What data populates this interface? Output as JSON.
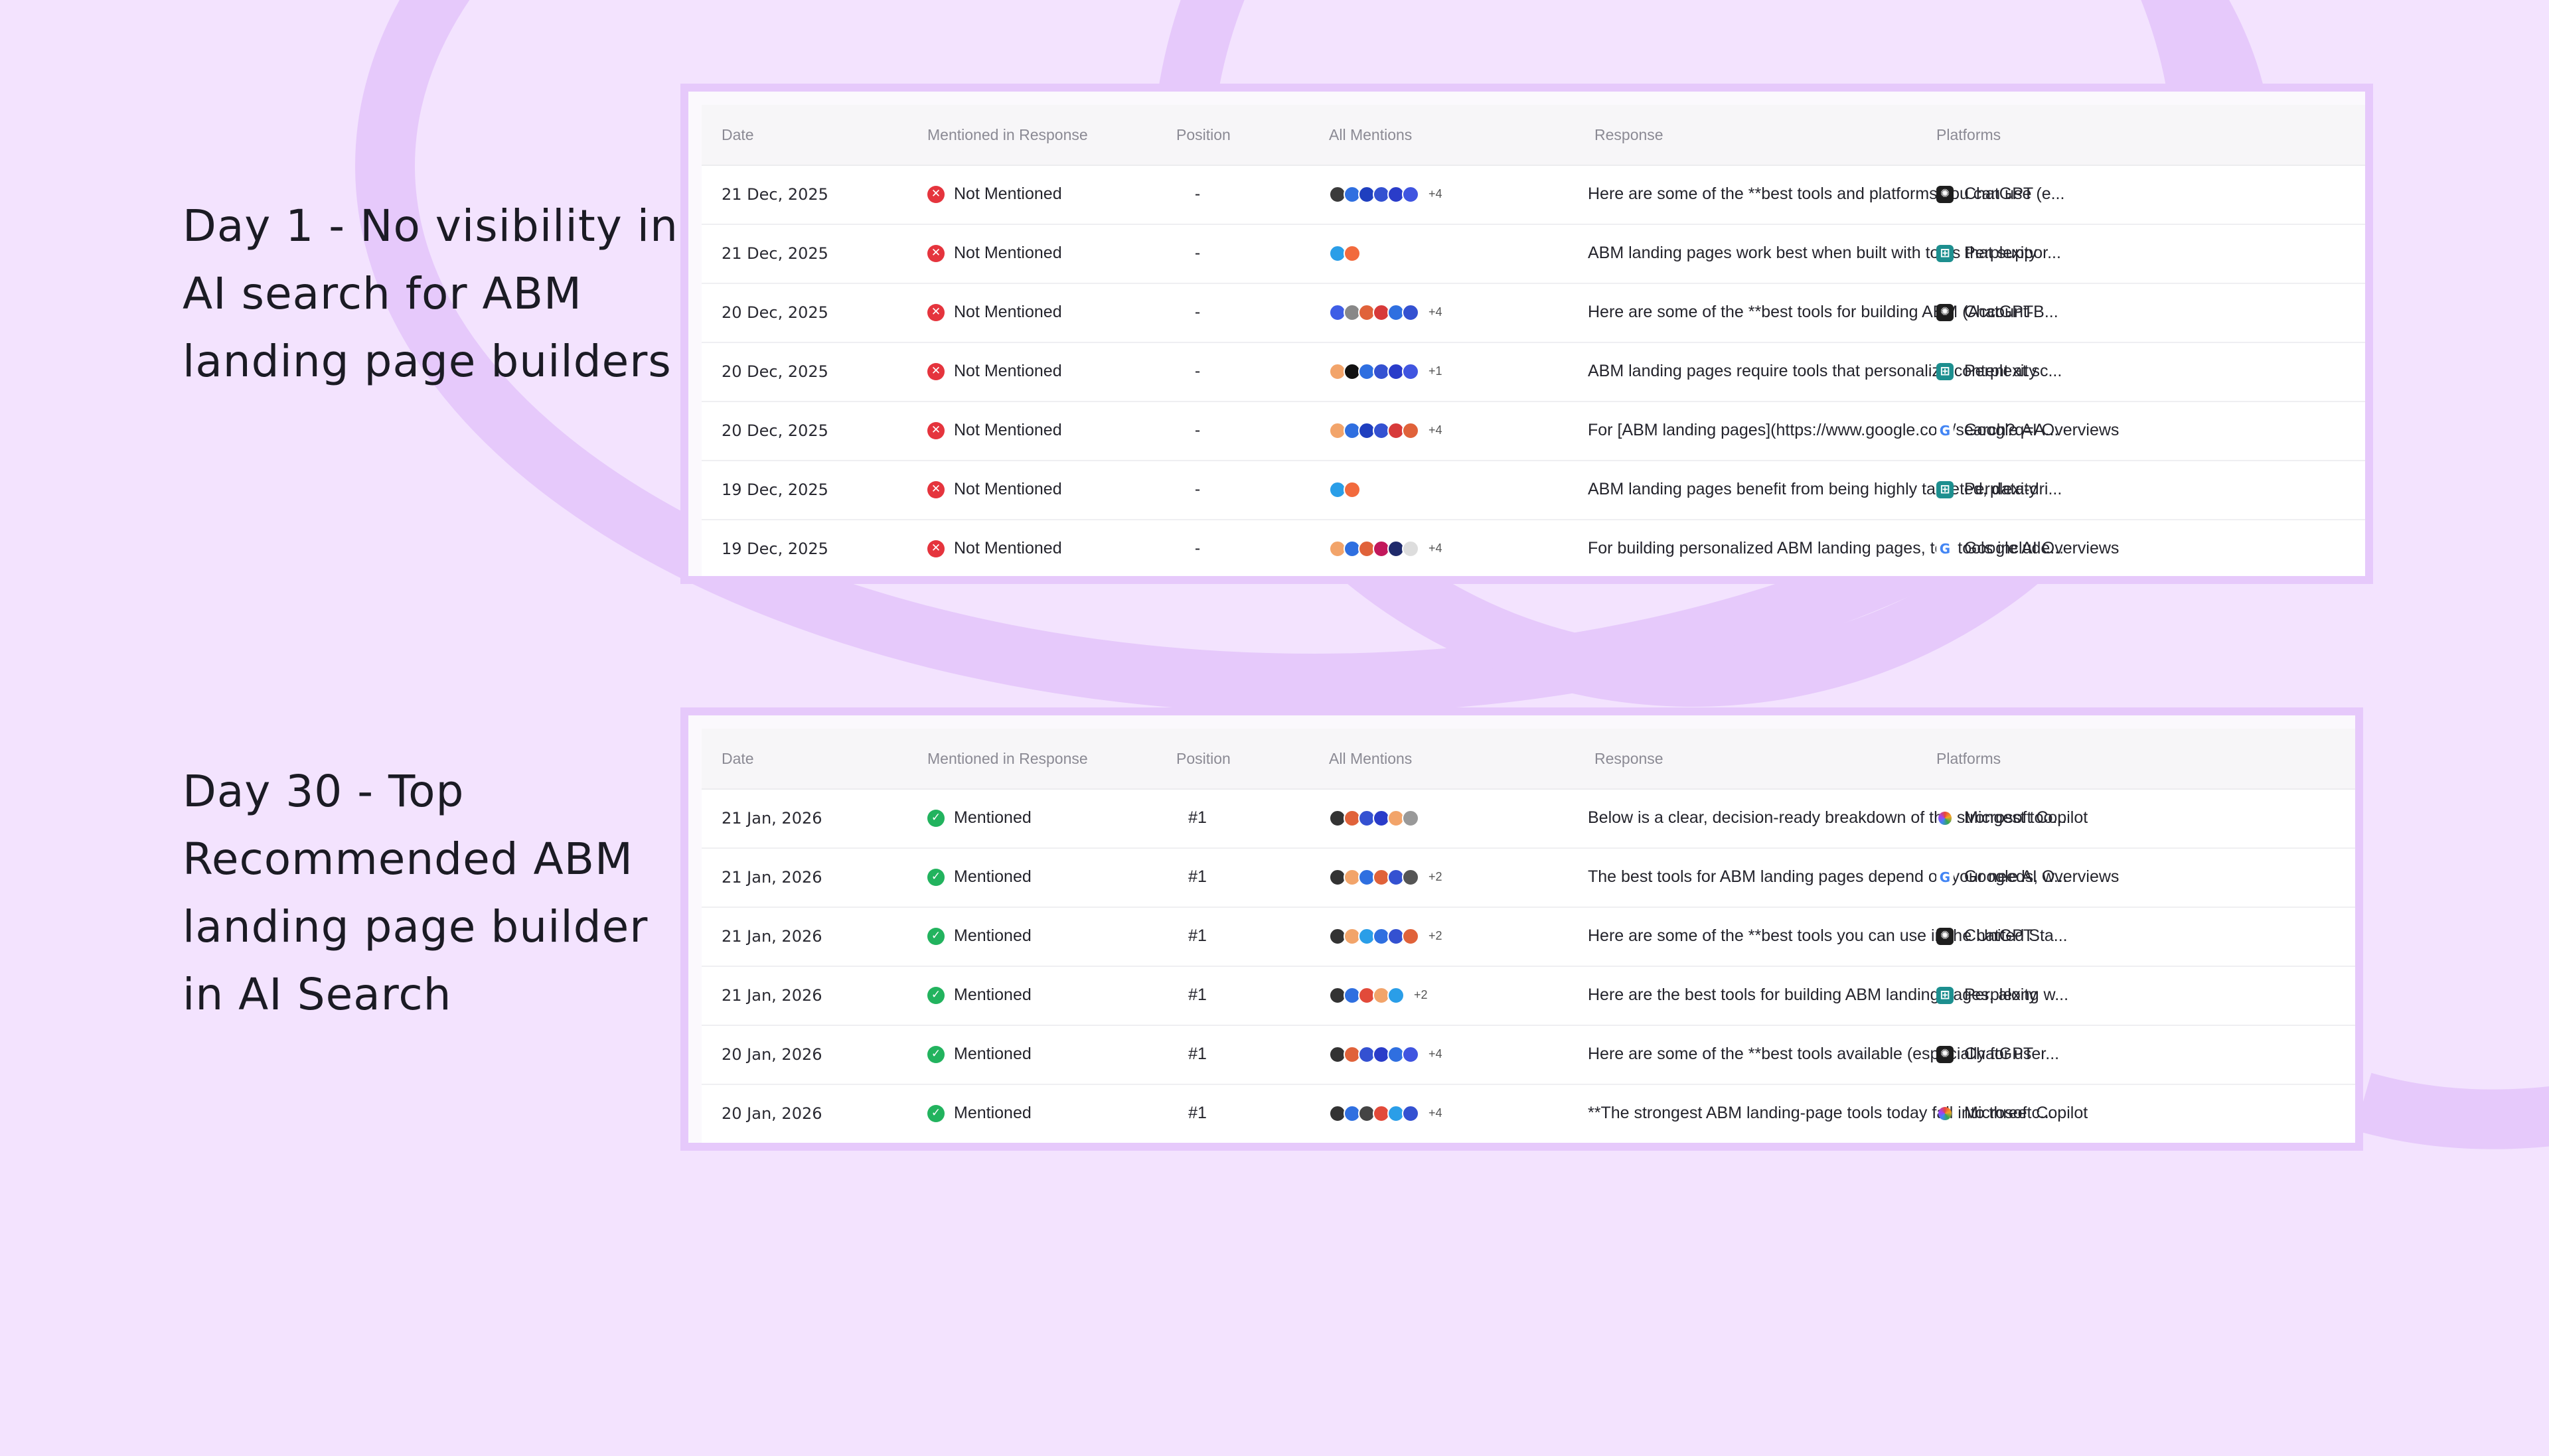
{
  "caption_day1": "Day 1 - No visibility in\nAI search for ABM\nlanding page builders",
  "caption_day30": "Day 30 - Top\nRecommended ABM\nlanding page builder\nin AI Search",
  "columns": {
    "date": "Date",
    "mentioned": "Mentioned in Response",
    "position": "Position",
    "all_mentions": "All Mentions",
    "response": "Response",
    "platforms": "Platforms"
  },
  "colors": {
    "background": "#f3e3fe",
    "accent_purple": "#e6c9fb",
    "not_mentioned_red": "#e5343d",
    "mentioned_green": "#22b35e"
  },
  "table_day1": [
    {
      "date": "21 Dec, 2025",
      "status": "Not Mentioned",
      "status_icon": "x-circle-icon",
      "position": "-",
      "logos": [
        "#3b3b3b",
        "#2f6fe0",
        "#1f3fbf",
        "#3451d1",
        "#2a3cc9",
        "#4055e0"
      ],
      "extra": "+4",
      "response": "Here are some of the **best tools and platforms you can use (e...",
      "platform": "ChatGPT",
      "platform_icon": "chatgpt-icon",
      "platform_color": "#1e1e1e"
    },
    {
      "date": "21 Dec, 2025",
      "status": "Not Mentioned",
      "status_icon": "x-circle-icon",
      "position": "-",
      "logos": [
        "#2a9ee8",
        "#f26a3d"
      ],
      "extra": "",
      "response": "ABM landing pages work best when built with tools that suppor...",
      "platform": "Perplexity",
      "platform_icon": "perplexity-icon",
      "platform_color": "#1d8f8f"
    },
    {
      "date": "20 Dec, 2025",
      "status": "Not Mentioned",
      "status_icon": "x-circle-icon",
      "position": "-",
      "logos": [
        "#3f5ee6",
        "#888888",
        "#e0623a",
        "#d73a3a",
        "#2f6fe0",
        "#3451d1"
      ],
      "extra": "+4",
      "response": "Here are some of the **best tools for building ABM (Account-B...",
      "platform": "ChatGPT",
      "platform_icon": "chatgpt-icon",
      "platform_color": "#1e1e1e"
    },
    {
      "date": "20 Dec, 2025",
      "status": "Not Mentioned",
      "status_icon": "x-circle-icon",
      "position": "-",
      "logos": [
        "#f2a46a",
        "#111111",
        "#2f6fe0",
        "#3451d1",
        "#2a3cc9",
        "#4055e0"
      ],
      "extra": "+1",
      "response": "ABM landing pages require tools that personalize content at sc...",
      "platform": "Perplexity",
      "platform_icon": "perplexity-icon",
      "platform_color": "#1d8f8f"
    },
    {
      "date": "20 Dec, 2025",
      "status": "Not Mentioned",
      "status_icon": "x-circle-icon",
      "position": "-",
      "logos": [
        "#f2a46a",
        "#2f6fe0",
        "#1f3fbf",
        "#3451d1",
        "#d73a3a",
        "#e0623a"
      ],
      "extra": "+4",
      "response": "For [ABM landing pages](https://www.google.com/search?q=A...",
      "platform": "Google AI Overviews",
      "platform_icon": "google-icon",
      "platform_color": "#ffffff"
    },
    {
      "date": "19 Dec, 2025",
      "status": "Not Mentioned",
      "status_icon": "x-circle-icon",
      "position": "-",
      "logos": [
        "#2a9ee8",
        "#f26a3d"
      ],
      "extra": "",
      "response": "ABM landing pages benefit from being highly targeted, data-dri...",
      "platform": "Perplexity",
      "platform_icon": "perplexity-icon",
      "platform_color": "#1d8f8f"
    },
    {
      "date": "19 Dec, 2025",
      "status": "Not Mentioned",
      "status_icon": "x-circle-icon",
      "position": "-",
      "logos": [
        "#f2a46a",
        "#2f6fe0",
        "#e0623a",
        "#c2185b",
        "#1f2a6b",
        "#dddddd"
      ],
      "extra": "+4",
      "response": "For building personalized ABM landing pages, top tools include...",
      "platform": "Google AI Overviews",
      "platform_icon": "google-icon",
      "platform_color": "#ffffff"
    }
  ],
  "table_day30": [
    {
      "date": "21 Jan, 2026",
      "status": "Mentioned",
      "status_icon": "check-circle-icon",
      "position": "#1",
      "logos": [
        "#333333",
        "#e0623a",
        "#3451d1",
        "#2a3cc9",
        "#f2a46a",
        "#999999"
      ],
      "extra": "",
      "response": "Below is a clear, decision-ready breakdown of the strongest too...",
      "platform": "Microsoft Copilot",
      "platform_icon": "copilot-icon",
      "platform_color": "#ffffff"
    },
    {
      "date": "21 Jan, 2026",
      "status": "Mentioned",
      "status_icon": "check-circle-icon",
      "position": "#1",
      "logos": [
        "#333333",
        "#f2a46a",
        "#2f6fe0",
        "#e0623a",
        "#3451d1",
        "#555555"
      ],
      "extra": "+2",
      "response": "The best tools for ABM landing pages depend on your needs, w...",
      "platform": "Google AI Overviews",
      "platform_icon": "google-icon",
      "platform_color": "#ffffff"
    },
    {
      "date": "21 Jan, 2026",
      "status": "Mentioned",
      "status_icon": "check-circle-icon",
      "position": "#1",
      "logos": [
        "#333333",
        "#f2a46a",
        "#2a9ee8",
        "#2f6fe0",
        "#3451d1",
        "#e0623a"
      ],
      "extra": "+2",
      "response": "Here are some of the **best tools you can use in the United Sta...",
      "platform": "ChatGPT",
      "platform_icon": "chatgpt-icon",
      "platform_color": "#1e1e1e"
    },
    {
      "date": "21 Jan, 2026",
      "status": "Mentioned",
      "status_icon": "check-circle-icon",
      "position": "#1",
      "logos": [
        "#333333",
        "#2f6fe0",
        "#e24a3a",
        "#f2a46a",
        "#2a9ee8"
      ],
      "extra": "+2",
      "response": "Here are the best tools for building ABM landing pages, along w...",
      "platform": "Perplexity",
      "platform_icon": "perplexity-icon",
      "platform_color": "#1d8f8f"
    },
    {
      "date": "20 Jan, 2026",
      "status": "Mentioned",
      "status_icon": "check-circle-icon",
      "position": "#1",
      "logos": [
        "#333333",
        "#e0623a",
        "#3451d1",
        "#2a3cc9",
        "#2f6fe0",
        "#4055e0"
      ],
      "extra": "+4",
      "response": "Here are some of the **best tools available (especially for user...",
      "platform": "ChatGPT",
      "platform_icon": "chatgpt-icon",
      "platform_color": "#1e1e1e"
    },
    {
      "date": "20 Jan, 2026",
      "status": "Mentioned",
      "status_icon": "check-circle-icon",
      "position": "#1",
      "logos": [
        "#333333",
        "#2f6fe0",
        "#444444",
        "#e24a3a",
        "#2a9ee8",
        "#3451d1"
      ],
      "extra": "+4",
      "response": "**The strongest ABM landing-page tools today fall into three c...",
      "platform": "Microsoft Copilot",
      "platform_icon": "copilot-icon",
      "platform_color": "#ffffff"
    }
  ]
}
